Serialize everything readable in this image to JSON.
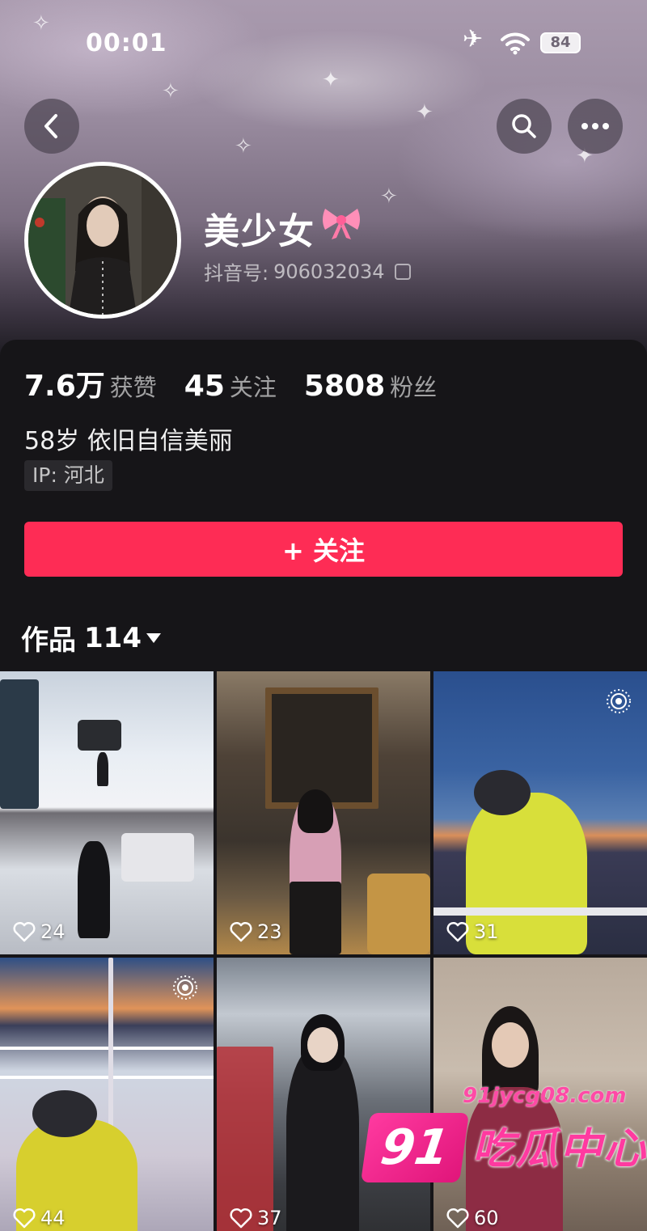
{
  "status_bar": {
    "time": "00:01",
    "battery": "84"
  },
  "profile": {
    "name": "美少女",
    "douyin_id_label": "抖音号:",
    "douyin_id": "906032034",
    "bio": "58岁 依旧自信美丽",
    "ip_label": "IP:",
    "ip_location": "河北"
  },
  "stats": [
    {
      "value": "7.6万",
      "label": "获赞"
    },
    {
      "value": "45",
      "label": "关注"
    },
    {
      "value": "5808",
      "label": "粉丝"
    }
  ],
  "follow_button": {
    "label": "+ 关注",
    "color": "#fe2c55"
  },
  "works": {
    "label": "作品",
    "count": "114"
  },
  "videos": [
    {
      "likes": "24",
      "live": false
    },
    {
      "likes": "23",
      "live": false
    },
    {
      "likes": "31",
      "live": true
    },
    {
      "likes": "44",
      "live": true
    },
    {
      "likes": "37",
      "live": false
    },
    {
      "likes": "60",
      "live": false
    }
  ],
  "icons": {
    "back": "back-arrow-icon",
    "search": "search-icon",
    "more": "more-dots-icon",
    "like": "heart-icon",
    "live_photo": "live-photo-icon",
    "copy": "copy-icon"
  },
  "watermark": {
    "url": "91jycg08.com",
    "badge": "91",
    "name": "吃瓜中心"
  }
}
